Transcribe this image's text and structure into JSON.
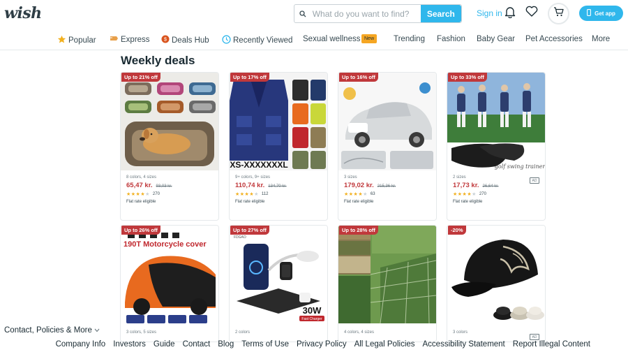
{
  "header": {
    "logo": "wish",
    "search_placeholder": "What do you want to find?",
    "search_button": "Search",
    "sign_in": "Sign in",
    "get_app": "Get app",
    "accent_color": "#2fb7ec"
  },
  "nav": {
    "items": [
      {
        "label": "Popular",
        "icon": "star-icon"
      },
      {
        "label": "Express",
        "icon": "express-icon"
      },
      {
        "label": "Deals Hub",
        "icon": "deals-icon"
      },
      {
        "label": "Recently Viewed",
        "icon": "clock-icon"
      },
      {
        "label": "Sexual wellness",
        "icon": ""
      },
      {
        "label": "Trending",
        "icon": ""
      },
      {
        "label": "Fashion",
        "icon": ""
      },
      {
        "label": "Baby Gear",
        "icon": ""
      },
      {
        "label": "Pet Accessories",
        "icon": ""
      },
      {
        "label": "More",
        "icon": ""
      }
    ],
    "new_badge": "New"
  },
  "section_title": "Weekly deals",
  "products": [
    {
      "badge": "Up to 21% off",
      "variants": "8 colors, 4 sizes",
      "price": "65,47 kr.",
      "old_price": "93,03 kr.",
      "rating": 4,
      "reviews": "270",
      "shipping": "Flat rate eligible",
      "image": "dog-bed"
    },
    {
      "badge": "Up to 17% off",
      "variants": "9+ colors, 9+ sizes",
      "price": "110,74 kr.",
      "old_price": "134,70 kr.",
      "rating": 4,
      "reviews": "112",
      "shipping": "Flat rate eligible",
      "image": "vests",
      "image_text": "XS-XXXXXXXL"
    },
    {
      "badge": "Up to 16% off",
      "variants": "3 sizes",
      "price": "179,02 kr.",
      "old_price": "215,36 kr.",
      "rating": 4,
      "reviews": "63",
      "shipping": "Flat rate eligible",
      "image": "car-cover"
    },
    {
      "badge": "Up to 33% off",
      "variants": "2 sizes",
      "price": "17,73 kr.",
      "old_price": "26,64 kr.",
      "rating": 4,
      "reviews": "270",
      "shipping": "Flat rate eligible",
      "image": "golf-trainer",
      "image_text": "golf swing trainer"
    },
    {
      "badge": "Up to 26% off",
      "variants": "3 colors, 5 sizes",
      "image": "motorcycle-cover",
      "image_text": "190T Motorcycle cover"
    },
    {
      "badge": "Up to 27% off",
      "variants": "2 colors",
      "image": "wireless-charger",
      "image_text": "30W",
      "image_subtext": "Fast Charger",
      "image_brand": "FDGAO"
    },
    {
      "badge": "Up to 28% off",
      "variants": "4 colors, 4 sizes",
      "image": "camo-net"
    },
    {
      "badge": "-20%",
      "variants": "3 colors",
      "image": "dragon-cap"
    }
  ],
  "footer": {
    "contact": "Contact, Policies & More",
    "links": [
      "Company Info",
      "Investors",
      "Guide",
      "Contact",
      "Blog",
      "Terms of Use",
      "Privacy Policy",
      "All Legal Policies",
      "Accessibility Statement",
      "Report Illegal Content"
    ]
  }
}
